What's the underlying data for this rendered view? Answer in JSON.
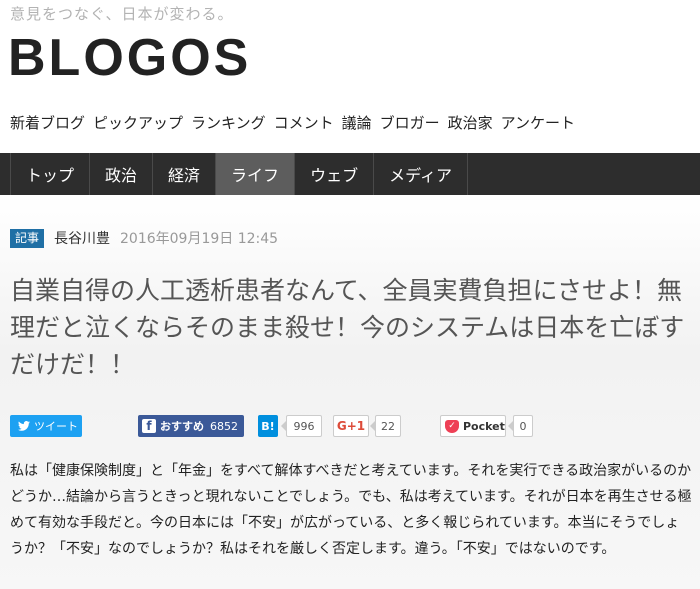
{
  "header": {
    "tagline": "意見をつなぐ、日本が変わる。",
    "logo": "BLOGOS"
  },
  "subnav": [
    "新着ブログ",
    "ピックアップ",
    "ランキング",
    "コメント",
    "議論",
    "ブロガー",
    "政治家",
    "アンケート"
  ],
  "mainnav": {
    "items": [
      "トップ",
      "政治",
      "経済",
      "ライフ",
      "ウェブ",
      "メディア"
    ],
    "active": "ライフ"
  },
  "article": {
    "badge": "記事",
    "author": "長谷川豊",
    "date": "2016年09月19日 12:45",
    "title": "自業自得の人工透析患者なんて、全員実費負担にさせよ！無理だと泣くならそのまま殺せ！今のシステムは日本を亡ぼすだけだ！！",
    "body": "私は「健康保険制度」と「年金」をすべて解体すべきだと考えています。それを実行できる政治家がいるのかどうか…結論から言うときっと現れないことでしょう。でも、私は考えています。それが日本を再生させる極めて有効な手段だと。今の日本には「不安」が広がっている、と多く報じられています。本当にそうでしょうか？「不安」なのでしょうか？私はそれを厳しく否定します。違う。「不安」ではないのです。"
  },
  "social": {
    "tweet_label": "ツイート",
    "fb_label": "おすすめ",
    "fb_count": "6852",
    "hatena_label": "B!",
    "hatena_count": "996",
    "gplus_label": "G+1",
    "gplus_count": "22",
    "pocket_label": "Pocket",
    "pocket_count": "0"
  },
  "colors": {
    "nav_bg": "#2d2d2d",
    "nav_active": "#5d5d5d",
    "badge": "#1f6fa5",
    "twitter": "#1da1f2",
    "facebook": "#3b5998",
    "hatena": "#008fde",
    "pocket": "#ee4056"
  }
}
